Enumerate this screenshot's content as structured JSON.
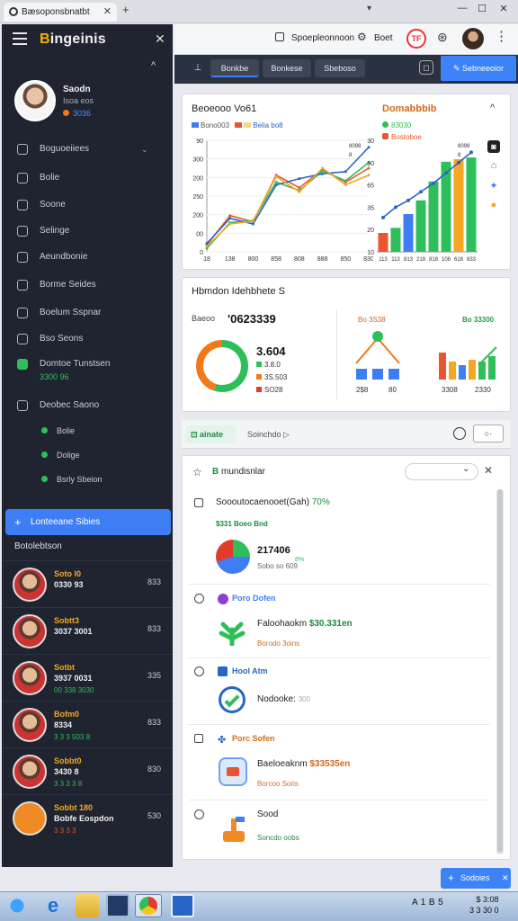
{
  "browser": {
    "tab_title": "Bæsoponsbnatbt",
    "close": "✕",
    "new_tab": "+",
    "dropdown": "▾",
    "win_min": "—",
    "win_max": "☐",
    "win_close": "✕"
  },
  "sidebar": {
    "brand_first": "B",
    "brand_rest": "ingeinis",
    "close": "✕",
    "collapse": "^",
    "profile": {
      "name": "Saodn",
      "role": "Isoa eos",
      "status": "3036"
    },
    "nav": [
      {
        "label": "Boguoeiiees",
        "chev": "⌄"
      },
      {
        "label": "Bolie"
      },
      {
        "label": "Soone"
      },
      {
        "label": "Selinge"
      },
      {
        "label": "Aeundbonie"
      },
      {
        "label": "Borme Seides"
      },
      {
        "label": "Boelum Sspnar"
      },
      {
        "label": "Bso Seons"
      }
    ],
    "green_item": {
      "label": "Domtoe Tunstsen",
      "sub": "3300 96"
    },
    "plain_item": {
      "label": "Deobec Saono"
    },
    "sub_items": [
      "Bolie",
      "Dolige",
      "Bsrly Sbeion"
    ],
    "active": {
      "label": "Lonteeane Sibies",
      "plus": "+"
    },
    "section": "Botolebtson",
    "users": [
      {
        "name": "Soto I0",
        "value": "0330 93",
        "sub": "",
        "meta": "833",
        "name_color": "#f5a623"
      },
      {
        "name": "Sobtt3",
        "value": "3037 3001",
        "sub": "",
        "meta": "833",
        "name_color": "#f5a623"
      },
      {
        "name": "Sotbt",
        "value": "3937 0031",
        "sub": "00 338 3030",
        "meta": "335",
        "name_color": "#f5a623"
      },
      {
        "name": "Bofm0",
        "value": "8334",
        "sub": "3 3 3 503 8",
        "meta": "833",
        "name_color": "#f5a623"
      },
      {
        "name": "Sobbt0",
        "value": "3430 8",
        "sub": "3 3 3 3 8",
        "meta": "830",
        "name_color": "#f5a623"
      },
      {
        "name": "Sobbt 180",
        "value": "Bobfe Eospdon",
        "sub": "3 3 3 3",
        "meta": "530",
        "name_color": "#f5a623"
      }
    ]
  },
  "header": {
    "link": "Spoepleonnoon",
    "label": "Boet",
    "badge": "TF",
    "more": "⋮"
  },
  "toolbar": {
    "icon": "⊥",
    "tabs": [
      "Bonkbe",
      "Bonkese",
      "Sbeboso"
    ],
    "circle": "◻",
    "primary": "Sebneeoior"
  },
  "card1": {
    "title": "Beoeooo Vo61",
    "legend": "Bono003",
    "legend_b": "Belia bo8",
    "title2": "Domabbbib",
    "legend2": "83030",
    "legend2_b": "Bostoboe",
    "caret": "^",
    "chart_left": {
      "type": "line",
      "x": [
        "18",
        "138",
        "800",
        "858",
        "808",
        "888",
        "850",
        "830"
      ],
      "series": [
        {
          "color": "#e8552f",
          "values": [
            10,
            52,
            43,
            110,
            92,
            118,
            100,
            120
          ]
        },
        {
          "color": "#2fbf5a",
          "values": [
            5,
            42,
            45,
            100,
            88,
            116,
            102,
            128
          ]
        },
        {
          "color": "#2766c6",
          "values": [
            12,
            48,
            40,
            96,
            105,
            112,
            115,
            150
          ]
        },
        {
          "color": "#f5a623",
          "values": [
            8,
            40,
            44,
            108,
            86,
            120,
            96,
            110
          ]
        }
      ],
      "ylim": [
        0,
        160
      ],
      "yticks": [
        "0",
        "00",
        "200",
        "250",
        "200",
        "300",
        "90"
      ],
      "legend": [
        "8098",
        "8"
      ]
    },
    "chart_right": {
      "type": "bar",
      "categories": [
        "113",
        "113",
        "813",
        "218",
        "818",
        "108",
        "618",
        "833"
      ],
      "values": [
        22,
        28,
        44,
        60,
        82,
        105,
        108,
        110
      ],
      "colors": [
        "#e8552f",
        "#2fbf5a",
        "#3d7ef5",
        "#2fbf5a",
        "#2fbf5a",
        "#2fbf5a",
        "#f5a623",
        "#2fbf5a"
      ],
      "line": [
        40,
        52,
        60,
        70,
        80,
        92,
        104,
        116
      ],
      "ylim": [
        0,
        130
      ],
      "yticks": [
        "10",
        "20",
        "35",
        "65",
        "90",
        "30"
      ],
      "legend": [
        "8098",
        "8"
      ]
    },
    "side_icons": [
      "◙",
      "⌂",
      "✦",
      "●"
    ]
  },
  "card2": {
    "title": "Hbmdon Idehbhete S",
    "prefix": "Baeoo",
    "big": "'0623339",
    "value": "3.604",
    "l1": "3.8.0",
    "l2": "3S.503",
    "l3": "SO28",
    "right_a": "Bo 3S38",
    "right_b": "Bo 33300",
    "t1": "2$8",
    "t2": "80",
    "t3": "3308",
    "t4": "2330",
    "donut": [
      {
        "color": "#2fbf5a",
        "value": 55
      },
      {
        "color": "#f07a1a",
        "value": 45
      }
    ],
    "small_bars": [
      {
        "values": [
          12,
          12,
          12
        ],
        "colors": [
          "#3d7ef5",
          "#3d7ef5",
          "#3d7ef5"
        ]
      },
      {
        "values": [
          30,
          20,
          16,
          22,
          20,
          26
        ],
        "colors": [
          "#e8552f",
          "#f5a623",
          "#3d7ef5",
          "#f5a623",
          "#2fbf5a",
          "#2fbf5a"
        ]
      }
    ]
  },
  "strip": {
    "tab1": "ainate",
    "tab2": "Soinchdo",
    "btn": "○·"
  },
  "panel": {
    "title_bold": "B",
    "title_rest": " mundisnlar",
    "close": "✕",
    "rows": [
      {
        "text": "Soooutocaenooet(Gah)",
        "pct": "70%",
        "sub": "$331 Boeo Bnd",
        "value": "217406",
        "value2": "Sobo so 609",
        "pct2": "8%"
      },
      {
        "title": "Poro Dofen",
        "main": "Faloohaokm",
        "main_val": "$30.331en",
        "sub": "Borodo 3oins"
      },
      {
        "title": "Hool Atm",
        "main": "Nodooke:",
        "main_val": "300"
      },
      {
        "title": "Porc Sofen",
        "main": "Baeloeaknm",
        "main_val": "$33535en",
        "sub": "Borcoo Soris"
      },
      {
        "title": "Sood",
        "sub": "Soncdo oobs"
      }
    ]
  },
  "fab": {
    "label": "Sodoies",
    "plus": "+",
    "close": "✕"
  },
  "taskbar": {
    "tray": "A 1 B 5",
    "time": "$ 3:08",
    "date": "3 3 30 0"
  }
}
